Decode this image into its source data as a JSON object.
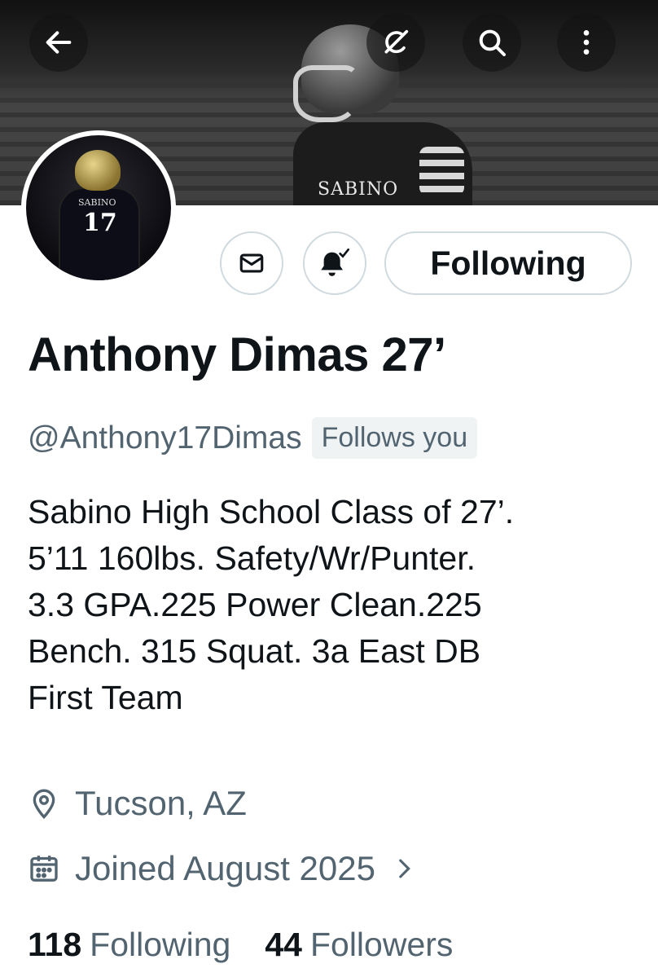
{
  "banner": {
    "jersey_text": "SABINO"
  },
  "avatar": {
    "jersey_name": "SABINO",
    "number": "17"
  },
  "actions": {
    "follow_label": "Following"
  },
  "profile": {
    "name": "Anthony Dimas 27’",
    "handle": "@Anthony17Dimas",
    "follows_you": "Follows you"
  },
  "bio": {
    "lines": [
      "Sabino High School Class of 27’.",
      "5’11 160lbs. Safety/Wr/Punter.",
      "3.3 GPA.225 Power Clean.225",
      "Bench. 315 Squat. 3a East DB",
      "First Team"
    ]
  },
  "meta": {
    "location": "Tucson, AZ",
    "joined": "Joined August 2025"
  },
  "stats": {
    "following_count": "118",
    "following_label": "Following",
    "followers_count": "44",
    "followers_label": "Followers"
  },
  "icons": [
    "back-arrow-icon",
    "grok-icon",
    "search-icon",
    "more-vertical-icon",
    "mail-icon",
    "bell-check-icon",
    "location-pin-icon",
    "calendar-icon",
    "chevron-right-icon"
  ],
  "colors": {
    "text": "#0f1419",
    "secondary": "#536471",
    "border": "#cfd9de",
    "badge_bg": "#eff3f4"
  }
}
